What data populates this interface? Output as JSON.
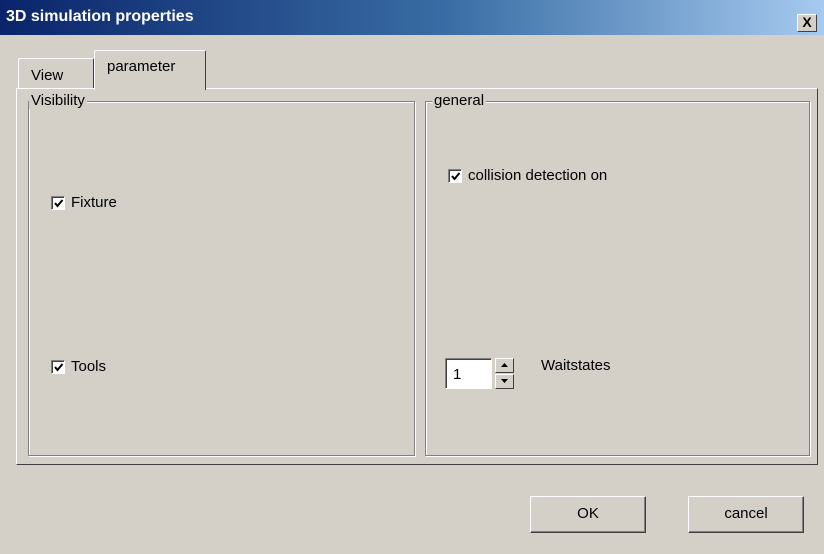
{
  "window": {
    "title": "3D simulation properties",
    "close_symbol": "X"
  },
  "tabs": [
    {
      "label": "View",
      "selected": false
    },
    {
      "label": "parameter",
      "selected": true
    }
  ],
  "visibility": {
    "legend": "Visibility",
    "fixture": {
      "label": "Fixture",
      "checked": true
    },
    "tools": {
      "label": "Tools",
      "checked": true
    }
  },
  "general": {
    "legend": "general",
    "collision": {
      "label": "collision detection on",
      "checked": true
    },
    "waitstates": {
      "value": "1",
      "label": "Waitstates"
    }
  },
  "buttons": {
    "ok": "OK",
    "cancel": "cancel"
  },
  "colors": {
    "face": "#d4d0c8",
    "title_start": "#0a246a",
    "title_end": "#a6caf0"
  }
}
